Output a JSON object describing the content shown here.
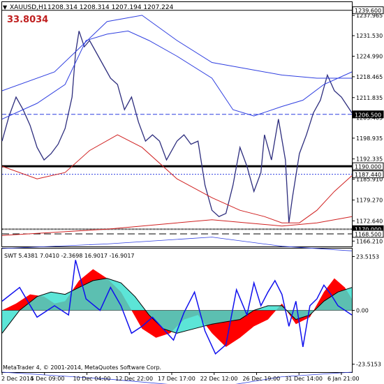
{
  "header": {
    "symbol": "XAUUSD,H1",
    "ohlc": "1208.314 1208.314 1207.194 1207.224",
    "big_value": "33.8034",
    "arrow_glyph": "▼"
  },
  "footer": {
    "copyright": "MetaTrader 4, © 2001-2014, MetaQuotes Software Corp."
  },
  "indicator": {
    "label": "SWT 5.4381 7.0410 -2.3698 16.9017 -16.9017"
  },
  "colors": {
    "background": "#ffffff",
    "price": "#2d2d7d",
    "ma_blue": "#2f3fe0",
    "ma_red": "#d02020",
    "highlight_price": "#ffffff",
    "teal": "#40e0d0",
    "red_fill": "#ff0000",
    "indicator_line": "#1010ee",
    "indicator_black": "#000000"
  },
  "chart_data": [
    {
      "type": "line",
      "title": "XAUUSD,H1",
      "y_ticks": [
        "1237.965",
        "1231.530",
        "1224.990",
        "1218.465",
        "1211.835",
        "1205.405",
        "1198.935",
        "1192.335",
        "1185.910",
        "1179.270",
        "1172.640",
        "1166.210"
      ],
      "x_ticks": [
        "2 Dec 2014",
        "5 Dec 09:00",
        "10 Dec 04:00",
        "12 Dec 22:00",
        "17 Dec 17:00",
        "22 Dec 12:00",
        "26 Dec 19:00",
        "31 Dec 14:00",
        "6 Jan 21:00"
      ],
      "ylim": [
        1164.5,
        1242.2
      ],
      "price_labels": [
        {
          "value": 1239.6,
          "text": "1239.600",
          "style": "outline"
        },
        {
          "value": 1206.5,
          "text": "1206.500",
          "style": "filled"
        },
        {
          "value": 1190.0,
          "text": "1190.000",
          "style": "outline"
        },
        {
          "value": 1187.44,
          "text": "1187.440",
          "style": "outline"
        },
        {
          "value": 1170.0,
          "text": "1170.000",
          "style": "filled"
        },
        {
          "value": 1168.5,
          "text": "1168.500",
          "style": "outline"
        }
      ],
      "horizontal_lines": [
        {
          "value": 1239.6,
          "style": "solid-thin"
        },
        {
          "value": 1206.5,
          "style": "dashed-blue"
        },
        {
          "value": 1190.0,
          "style": "solid-thick"
        },
        {
          "value": 1187.44,
          "style": "dotted-blue"
        },
        {
          "value": 1170.0,
          "style": "dotted-black"
        },
        {
          "value": 1168.5,
          "style": "dashed-black"
        }
      ],
      "series": [
        {
          "values": [
            [
              0,
              1198
            ],
            [
              0.02,
              1206
            ],
            [
              0.04,
              1212
            ],
            [
              0.06,
              1208
            ],
            [
              0.08,
              1203
            ],
            [
              0.1,
              1196
            ],
            [
              0.12,
              1192
            ],
            [
              0.14,
              1194
            ],
            [
              0.16,
              1197
            ],
            [
              0.18,
              1202
            ],
            [
              0.2,
              1212
            ],
            [
              0.21,
              1226
            ],
            [
              0.22,
              1233
            ],
            [
              0.235,
              1228
            ],
            [
              0.25,
              1230
            ],
            [
              0.27,
              1226
            ],
            [
              0.29,
              1222
            ],
            [
              0.31,
              1218
            ],
            [
              0.33,
              1216
            ],
            [
              0.35,
              1208
            ],
            [
              0.37,
              1212
            ],
            [
              0.39,
              1204
            ],
            [
              0.41,
              1198
            ],
            [
              0.43,
              1200
            ],
            [
              0.45,
              1198
            ],
            [
              0.47,
              1192
            ],
            [
              0.5,
              1198
            ],
            [
              0.52,
              1200
            ],
            [
              0.54,
              1197
            ],
            [
              0.56,
              1198
            ],
            [
              0.58,
              1184
            ],
            [
              0.6,
              1176
            ],
            [
              0.62,
              1174
            ],
            [
              0.64,
              1175
            ],
            [
              0.66,
              1184
            ],
            [
              0.68,
              1196
            ],
            [
              0.7,
              1190
            ],
            [
              0.72,
              1182
            ],
            [
              0.74,
              1188
            ],
            [
              0.75,
              1200
            ],
            [
              0.77,
              1192
            ],
            [
              0.79,
              1205
            ],
            [
              0.81,
              1192
            ],
            [
              0.82,
              1172
            ],
            [
              0.83,
              1180
            ],
            [
              0.85,
              1194
            ],
            [
              0.87,
              1200
            ],
            [
              0.89,
              1207
            ],
            [
              0.91,
              1211
            ],
            [
              0.93,
              1219
            ],
            [
              0.95,
              1214
            ],
            [
              0.97,
              1212
            ],
            [
              1.0,
              1207
            ]
          ]
        },
        {
          "values": [
            [
              0,
              1205
            ],
            [
              0.1,
              1210
            ],
            [
              0.18,
              1216
            ],
            [
              0.24,
              1230
            ],
            [
              0.3,
              1232
            ],
            [
              0.36,
              1233
            ],
            [
              0.42,
              1230
            ],
            [
              0.5,
              1225
            ],
            [
              0.6,
              1218
            ],
            [
              0.66,
              1208
            ],
            [
              0.72,
              1206
            ],
            [
              0.8,
              1209
            ],
            [
              0.86,
              1211
            ],
            [
              0.92,
              1216
            ],
            [
              1.0,
              1220
            ]
          ]
        },
        {
          "values": [
            [
              0,
              1214
            ],
            [
              0.15,
              1220
            ],
            [
              0.3,
              1236
            ],
            [
              0.4,
              1238
            ],
            [
              0.5,
              1230
            ],
            [
              0.6,
              1223
            ],
            [
              0.7,
              1221
            ],
            [
              0.8,
              1219
            ],
            [
              0.9,
              1218
            ],
            [
              1.0,
              1218
            ]
          ]
        },
        {
          "values": [
            [
              0,
              1190
            ],
            [
              0.1,
              1186
            ],
            [
              0.18,
              1188
            ],
            [
              0.25,
              1195
            ],
            [
              0.33,
              1200
            ],
            [
              0.4,
              1196
            ],
            [
              0.5,
              1186
            ],
            [
              0.6,
              1180
            ],
            [
              0.68,
              1176
            ],
            [
              0.75,
              1174
            ],
            [
              0.8,
              1172
            ],
            [
              0.85,
              1172
            ],
            [
              0.9,
              1176
            ],
            [
              0.95,
              1182
            ],
            [
              1.0,
              1187
            ]
          ]
        },
        {
          "values": [
            [
              0,
              1168
            ],
            [
              0.3,
              1170
            ],
            [
              0.5,
              1172
            ],
            [
              0.6,
              1173
            ],
            [
              0.7,
              1172
            ],
            [
              0.8,
              1171
            ],
            [
              0.9,
              1172
            ],
            [
              1.0,
              1174
            ]
          ]
        }
      ]
    },
    {
      "type": "area",
      "title": "SWT 5.4381 7.0410 -2.3698 16.9017 -16.9017",
      "y_ticks": [
        "23.5153",
        "0.00",
        "-23.5153"
      ],
      "ylim": [
        -27,
        27
      ],
      "series": [
        {
          "values": [
            [
              0,
              0
            ],
            [
              0.04,
              3
            ],
            [
              0.08,
              7
            ],
            [
              0.12,
              6
            ],
            [
              0.15,
              3
            ],
            [
              0.18,
              4
            ],
            [
              0.22,
              13
            ],
            [
              0.26,
              18
            ],
            [
              0.3,
              14
            ],
            [
              0.34,
              8
            ],
            [
              0.37,
              0
            ],
            [
              0.4,
              -8
            ],
            [
              0.44,
              -12
            ],
            [
              0.48,
              -10
            ],
            [
              0.52,
              -4
            ],
            [
              0.56,
              -2
            ],
            [
              0.6,
              -10
            ],
            [
              0.64,
              -16
            ],
            [
              0.68,
              -12
            ],
            [
              0.72,
              -7
            ],
            [
              0.76,
              -4
            ],
            [
              0.8,
              3
            ],
            [
              0.84,
              -6
            ],
            [
              0.88,
              -3
            ],
            [
              0.92,
              8
            ],
            [
              0.95,
              14
            ],
            [
              0.98,
              10
            ],
            [
              1.0,
              5
            ]
          ]
        },
        {
          "values": [
            [
              0,
              -10
            ],
            [
              0.05,
              0
            ],
            [
              0.1,
              6
            ],
            [
              0.14,
              8
            ],
            [
              0.18,
              7
            ],
            [
              0.22,
              10
            ],
            [
              0.26,
              13
            ],
            [
              0.3,
              14
            ],
            [
              0.34,
              12
            ],
            [
              0.38,
              6
            ],
            [
              0.42,
              -2
            ],
            [
              0.46,
              -8
            ],
            [
              0.5,
              -10
            ],
            [
              0.55,
              -8
            ],
            [
              0.6,
              -6
            ],
            [
              0.64,
              -5
            ],
            [
              0.68,
              -4
            ],
            [
              0.72,
              0
            ],
            [
              0.76,
              2
            ],
            [
              0.8,
              2
            ],
            [
              0.84,
              -4
            ],
            [
              0.88,
              -2
            ],
            [
              0.92,
              4
            ],
            [
              0.96,
              8
            ],
            [
              1.0,
              10
            ]
          ]
        },
        {
          "values": [
            [
              0,
              4
            ],
            [
              0.05,
              10
            ],
            [
              0.1,
              -3
            ],
            [
              0.15,
              2
            ],
            [
              0.19,
              -2
            ],
            [
              0.21,
              22
            ],
            [
              0.24,
              5
            ],
            [
              0.28,
              0
            ],
            [
              0.31,
              10
            ],
            [
              0.34,
              2
            ],
            [
              0.37,
              -10
            ],
            [
              0.4,
              -7
            ],
            [
              0.43,
              -3
            ],
            [
              0.46,
              -8
            ],
            [
              0.49,
              -13
            ],
            [
              0.52,
              -1
            ],
            [
              0.55,
              8
            ],
            [
              0.58,
              -9
            ],
            [
              0.61,
              -19
            ],
            [
              0.64,
              -15
            ],
            [
              0.67,
              9
            ],
            [
              0.7,
              -2
            ],
            [
              0.72,
              12
            ],
            [
              0.74,
              2
            ],
            [
              0.76,
              8
            ],
            [
              0.78,
              13
            ],
            [
              0.8,
              7
            ],
            [
              0.82,
              -7
            ],
            [
              0.84,
              4
            ],
            [
              0.86,
              -16
            ],
            [
              0.88,
              2
            ],
            [
              0.9,
              5
            ],
            [
              0.92,
              11
            ],
            [
              0.94,
              7
            ],
            [
              0.96,
              2
            ],
            [
              1.0,
              -2
            ]
          ]
        },
        {
          "values": [
            [
              0,
              27
            ],
            [
              0.3,
              29
            ],
            [
              0.6,
              32
            ],
            [
              0.8,
              28
            ],
            [
              1.0,
              26
            ]
          ]
        },
        {
          "values": [
            [
              0,
              -27
            ],
            [
              0.3,
              -30
            ],
            [
              0.6,
              -34
            ],
            [
              0.8,
              -29
            ],
            [
              1.0,
              -27
            ]
          ]
        }
      ]
    }
  ]
}
